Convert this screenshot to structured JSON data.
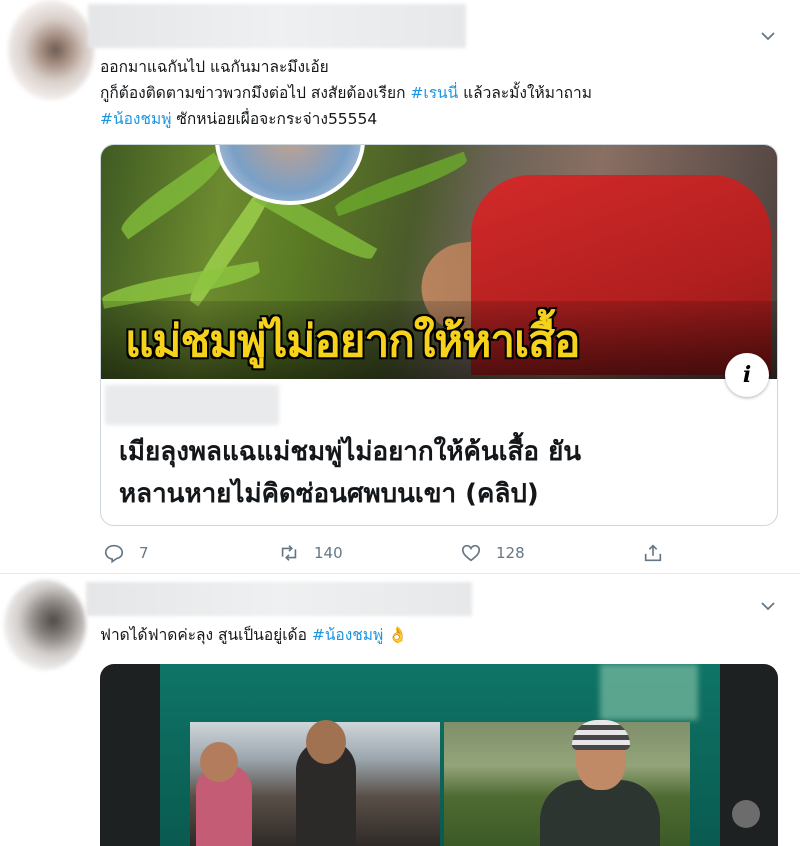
{
  "tweet1": {
    "text": {
      "line1": "ออกมาแฉกันไป แฉกันมาละมึงเอ้ย",
      "line2_before": "กูก็ต้องติดตามข่าวพวกมึงต่อไป สงสัยต้องเรียก ",
      "line2_hashtag": "#เรนนี่",
      "line2_after": " แล้วละมั้งให้มาถาม",
      "line3_hashtag": "#น้องชมพู่",
      "line3_after": " ซักหน่อยเผื่อจะกระจ่าง55554"
    },
    "card": {
      "image_headline": "แม่ชมพู่ไม่อยากให้หาเสื้อ",
      "title_line1": "เมียลุงพลแฉแม่ชมพู่ไม่อยากให้ค้นเสื้อ ยัน",
      "title_line2": "หลานหายไม่คิดซ่อนศพบนเขา (คลิป)",
      "info_glyph": "i"
    },
    "actions": {
      "reply_count": "7",
      "retweet_count": "140",
      "like_count": "128"
    }
  },
  "tweet2": {
    "text": {
      "before": "ฟาดได้ฟาดค่ะลุง สูนเป็นอยู่เด้อ ",
      "hashtag": "#น้องชมพู่",
      "emoji": "👌"
    }
  },
  "icons": {
    "chevron": "chevron-down-icon",
    "reply": "reply-icon",
    "retweet": "retweet-icon",
    "like": "heart-icon",
    "share": "share-icon"
  },
  "colors": {
    "hashtag": "#1b95e0",
    "icon_gray": "#657786",
    "headline_yellow": "#f7d21a"
  }
}
